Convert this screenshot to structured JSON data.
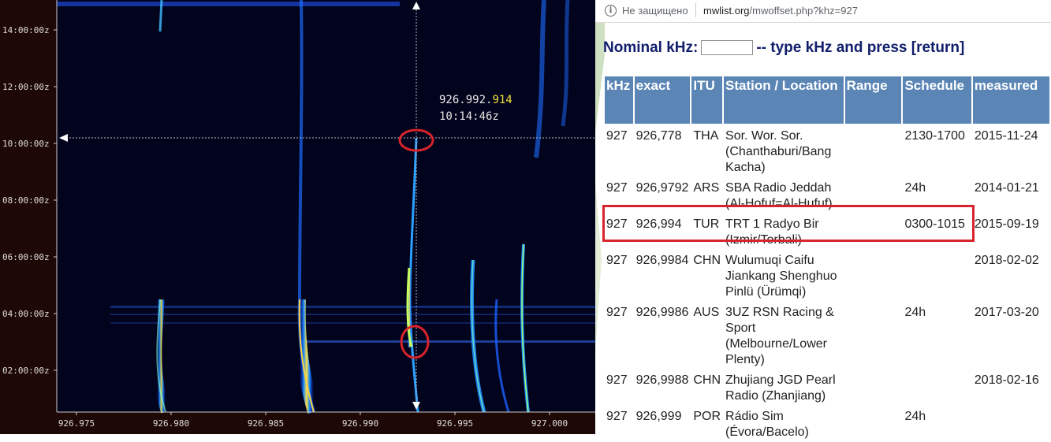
{
  "spectrogram": {
    "time_labels": [
      "14:00:00z",
      "12:00:00z",
      "10:00:00z",
      "08:00:00z",
      "06:00:00z",
      "04:00:00z",
      "02:00:00z"
    ],
    "freq_labels": [
      "926.975",
      "926.980",
      "926.985",
      "926.990",
      "926.995",
      "927.000"
    ],
    "cursor_freq_main": "926.992.",
    "cursor_freq_fine": "914",
    "cursor_time": "10:14:46z",
    "colors": {
      "background": "#1e0806",
      "plot_bg": "#02031c",
      "marker": "#d7242c",
      "fine_digits": "#f0e040"
    }
  },
  "browser": {
    "security_text": "Не защищено",
    "url_domain": "mwlist.org",
    "url_path": "/mwoffset.php?khz=927",
    "nominal_label": "Nominal kHz:",
    "nominal_value": "",
    "nominal_hint": "-- type kHz and press [return]",
    "headers": [
      "kHz",
      "exact",
      "ITU",
      "Station / Location",
      "Range",
      "Schedule",
      "measured"
    ],
    "rows": [
      [
        "927",
        "926,778",
        "THA",
        "Sor. Wor. Sor. (Chanthaburi/Bang Kacha)",
        "",
        "2130-1700",
        "2015-11-24"
      ],
      [
        "927",
        "926,9792",
        "ARS",
        "SBA Radio Jeddah (Al-Hofuf=Al-Hufuf)",
        "",
        "24h",
        "2014-01-21"
      ],
      [
        "927",
        "926,994",
        "TUR",
        "TRT 1 Radyo Bir (Izmir/Torbali)",
        "",
        "0300-1015",
        "2015-09-19"
      ],
      [
        "927",
        "926,9984",
        "CHN",
        "Wulumuqi Caifu Jiankang Shenghuo Pinlü (Ürümqi)",
        "",
        "",
        "2018-02-02"
      ],
      [
        "927",
        "926,9986",
        "AUS",
        "3UZ RSN Racing & Sport (Melbourne/Lower Plenty)",
        "",
        "24h",
        "2017-03-20"
      ],
      [
        "927",
        "926,9988",
        "CHN",
        "Zhujiang JGD Pearl Radio (Zhanjiang)",
        "",
        "",
        "2018-02-16"
      ],
      [
        "927",
        "926,999",
        "POR",
        "Rádio Sim (Évora/Bacelo)",
        "",
        "24h",
        ""
      ]
    ],
    "colors": {
      "header_bg": "#5a85b5",
      "title": "#111e6b",
      "highlight": "#d7242c"
    }
  }
}
